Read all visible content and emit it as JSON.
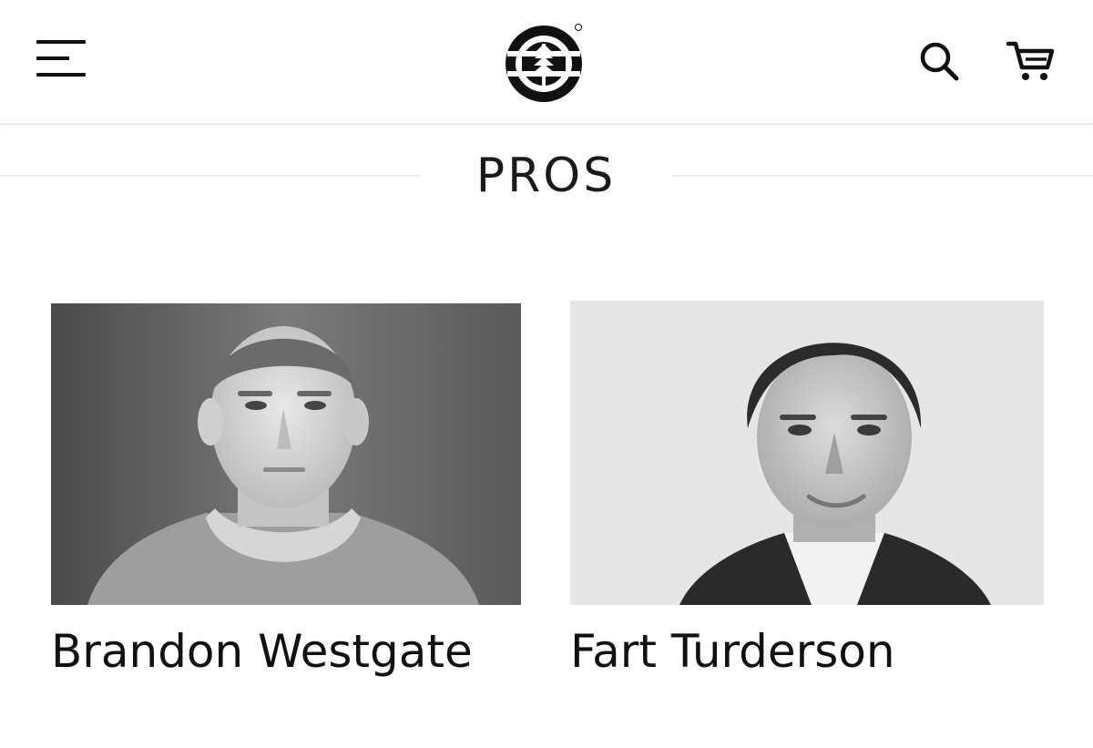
{
  "header": {
    "menu_icon": "hamburger-menu-icon",
    "logo_icon": "element-tree-logo",
    "search_icon": "search-icon",
    "cart_icon": "cart-icon"
  },
  "section": {
    "title": "PROS"
  },
  "pros": [
    {
      "name": "Brandon Westgate",
      "photo": "black-and-white portrait, man with buzz cut in gray hoodie"
    },
    {
      "name": "Fart Turderson",
      "photo": "black-and-white portrait, man with swept dark hair in dark blazer"
    }
  ]
}
